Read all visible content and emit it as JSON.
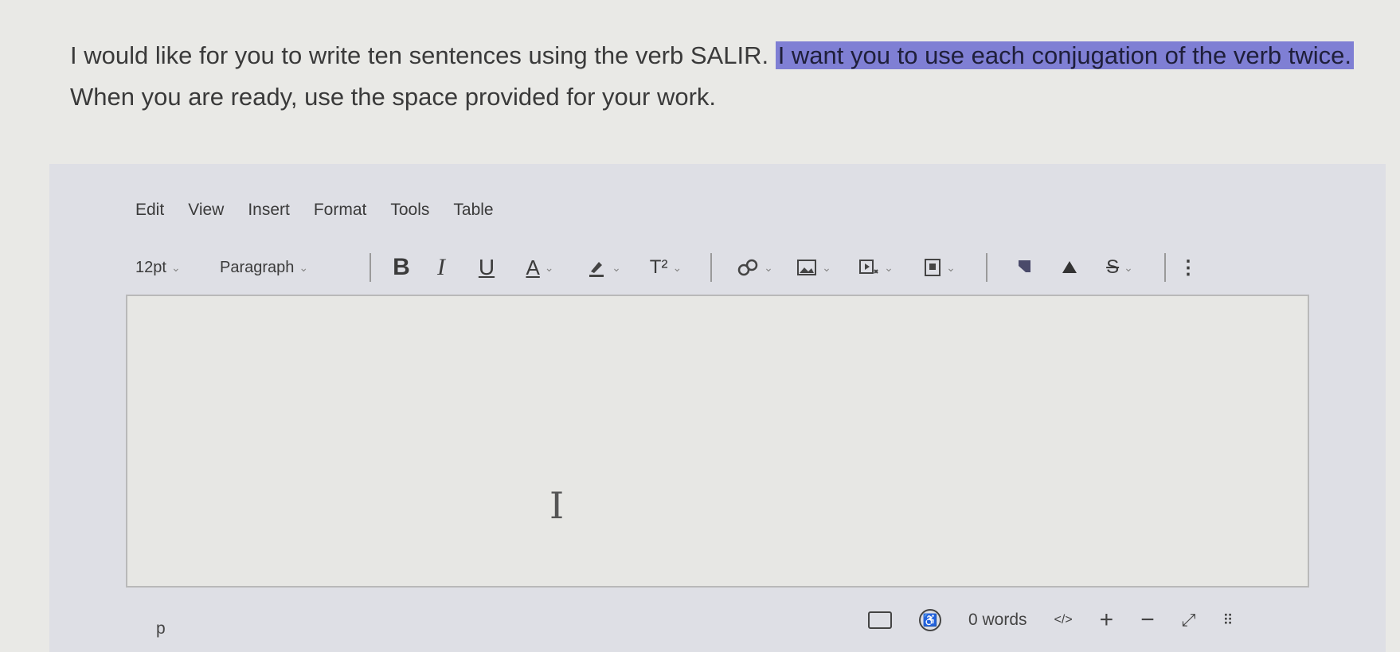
{
  "instructions": {
    "line1_before": "I would like for you to write ten sentences using the verb SALIR. ",
    "line1_highlight": "I want you to use each conjugation of the verb twice.",
    "line2": "When you are ready, use the space provided for your work."
  },
  "menu": [
    "Edit",
    "View",
    "Insert",
    "Format",
    "Tools",
    "Table"
  ],
  "toolbar": {
    "font_size": "12pt",
    "block_format": "Paragraph",
    "bold": "B",
    "italic": "I",
    "underline": "U",
    "text_color": "A",
    "superscript": "T²",
    "more": "⋮"
  },
  "status": {
    "path": "p",
    "word_count": "0 words",
    "html_view": "</>",
    "zoom_in": "+",
    "zoom_out": "−"
  },
  "colors": {
    "highlight": "#7f7fd4",
    "panel": "#dedfe5",
    "editor": "#e7e7e4"
  }
}
